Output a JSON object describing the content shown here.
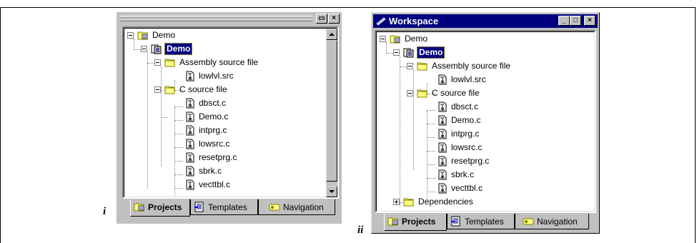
{
  "labels": {
    "panel_i": "i",
    "panel_ii": "ii"
  },
  "workspace_title": "Workspace",
  "tree": {
    "root": "Demo",
    "project": "Demo",
    "folder_asm": "Assembly source file",
    "asm_files": [
      "lowlvl.src"
    ],
    "folder_c": "C source file",
    "c_files": [
      "dbsct.c",
      "Demo.c",
      "intprg.c",
      "lowsrc.c",
      "resetprg.c",
      "sbrk.c",
      "vecttbl.c"
    ],
    "folder_dep": "Dependencies"
  },
  "tabs": {
    "projects": "Projects",
    "templates": "Templates",
    "navigation": "Navigation"
  },
  "window_buttons": {
    "restore": "▭",
    "close": "×",
    "minimize": "_",
    "maximize": "□"
  },
  "icon_names": [
    "workspace-icon",
    "project-icon",
    "folder-icon",
    "file-icon",
    "projects-tab-icon",
    "templates-tab-icon",
    "navigation-tab-icon"
  ]
}
